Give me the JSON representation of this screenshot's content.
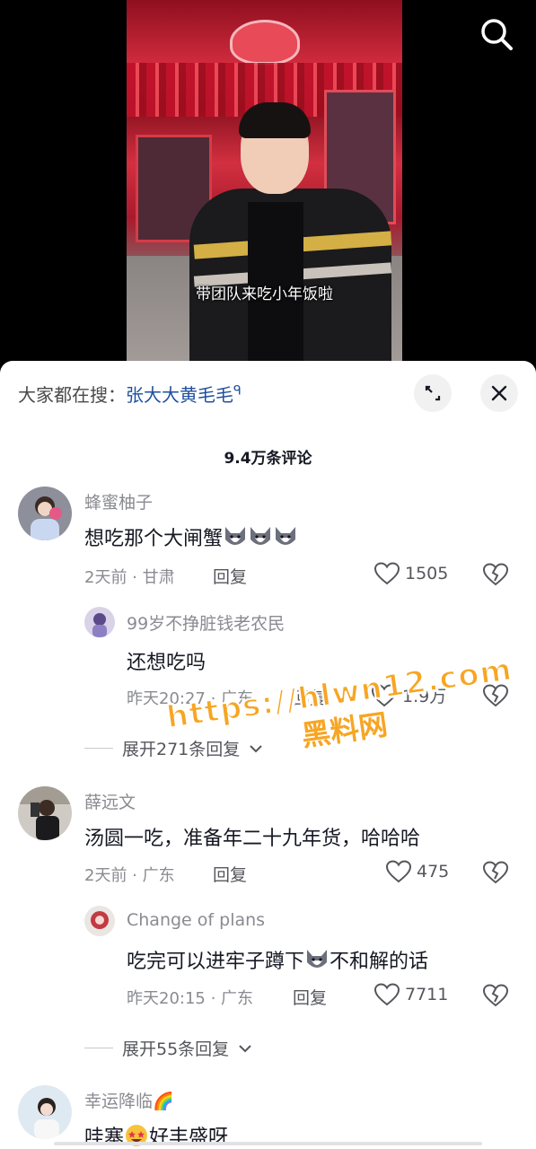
{
  "video": {
    "subtitle": "带团队来吃小年饭啦"
  },
  "sheet": {
    "search_prefix": "大家都在搜：",
    "search_keyword": "张大大黄毛毛",
    "search_glyph": "ᑫ",
    "comment_count": "9.4万条评论"
  },
  "comments": [
    {
      "user": "蜂蜜柚子",
      "text": "想吃那个大闸蟹",
      "meta": "2天前 · 甘肃",
      "reply": "回复",
      "likes": "1505"
    },
    {
      "user": "99岁不挣脏钱老农民",
      "text": "还想吃吗",
      "meta": "昨天20:27 · 广东",
      "reply": "回复",
      "likes": "1.9万"
    },
    {
      "expand": "展开271条回复"
    },
    {
      "user": "薛远文",
      "text": "汤圆一吃，准备年二十九年货，哈哈哈",
      "meta": "2天前 · 广东",
      "reply": "回复",
      "likes": "475"
    },
    {
      "user": "Change of plans",
      "text_before": "吃完可以进牢子蹲下",
      "text_after": "不和解的话",
      "meta": "昨天20:15 · 广东",
      "reply": "回复",
      "likes": "7711"
    },
    {
      "expand": "展开55条回复"
    },
    {
      "user": "幸运降临🌈",
      "text_before": "哇塞",
      "text_after": "好丰盛呀"
    }
  ],
  "watermark": {
    "url": "https://hlwn12.com",
    "text": "黑料网"
  },
  "icons": {
    "search": "search-icon",
    "expand": "expand-icon",
    "close": "close-icon",
    "like": "heart-icon",
    "dislike": "broken-heart-icon",
    "chevron": "chevron-down-icon"
  }
}
